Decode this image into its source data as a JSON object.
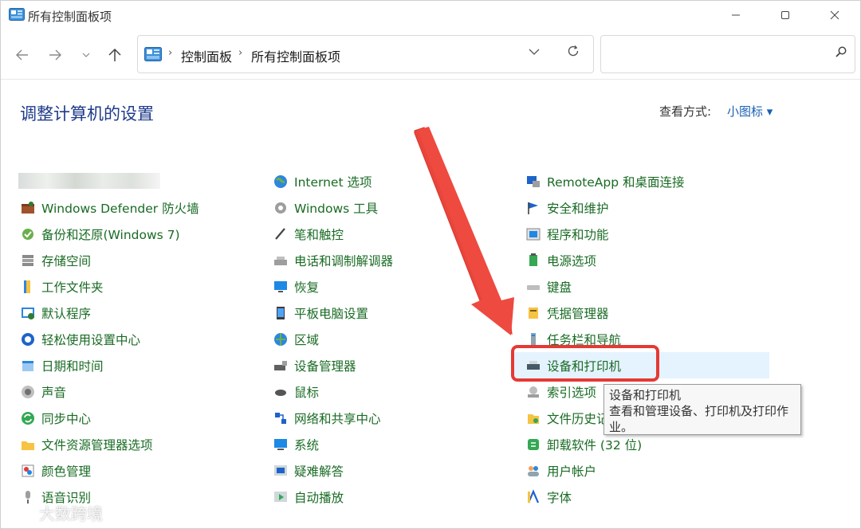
{
  "window": {
    "title": "所有控制面板项"
  },
  "nav": {
    "breadcrumb": [
      "控制面板",
      "所有控制面板项"
    ],
    "search_placeholder": ""
  },
  "header": {
    "title": "调整计算机的设置",
    "view_label": "查看方式:",
    "view_value": "小图标 ▾"
  },
  "columns": {
    "col1": [
      "Windows Defender 防火墙",
      "备份和还原(Windows 7)",
      "存储空间",
      "工作文件夹",
      "默认程序",
      "轻松使用设置中心",
      "日期和时间",
      "声音",
      "同步中心",
      "文件资源管理器选项",
      "颜色管理",
      "语音识别"
    ],
    "col2": [
      "Internet 选项",
      "Windows 工具",
      "笔和触控",
      "电话和调制解调器",
      "恢复",
      "平板电脑设置",
      "区域",
      "设备管理器",
      "鼠标",
      "网络和共享中心",
      "系统",
      "疑难解答",
      "自动播放"
    ],
    "col3": [
      "RemoteApp 和桌面连接",
      "安全和维护",
      "程序和功能",
      "电源选项",
      "键盘",
      "凭据管理器",
      "任务栏和导航",
      "设备和打印机",
      "索引选项",
      "文件历史记",
      "卸载软件 (32 位)",
      "用户帐户",
      "字体"
    ]
  },
  "tooltip": {
    "title": "设备和打印机",
    "body": "查看和管理设备、打印机及打印作业。"
  },
  "watermark": "大数跨境",
  "colors": {
    "link": "#196b24",
    "title": "#1e3a8a",
    "highlight": "#e5f3ff",
    "annotation": "#e53935"
  }
}
